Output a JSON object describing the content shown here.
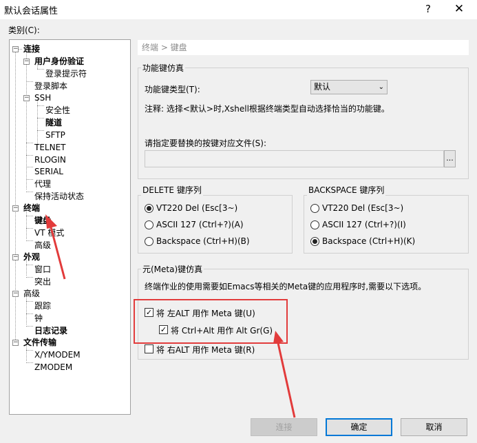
{
  "window": {
    "title": "默认会话属性",
    "help_label": "?",
    "close_label": "✕"
  },
  "category_label": "类别(C):",
  "tree": [
    {
      "label": "连接",
      "bold": true
    },
    {
      "label": "用户身份验证",
      "bold": true
    },
    {
      "label": "登录提示符",
      "bold": false
    },
    {
      "label": "登录脚本",
      "bold": false
    },
    {
      "label": "SSH",
      "bold": false
    },
    {
      "label": "安全性",
      "bold": false
    },
    {
      "label": "隧道",
      "bold": true
    },
    {
      "label": "SFTP",
      "bold": false
    },
    {
      "label": "TELNET",
      "bold": false
    },
    {
      "label": "RLOGIN",
      "bold": false
    },
    {
      "label": "SERIAL",
      "bold": false
    },
    {
      "label": "代理",
      "bold": false
    },
    {
      "label": "保持活动状态",
      "bold": false
    },
    {
      "label": "终端",
      "bold": true
    },
    {
      "label": "键盘",
      "bold": true
    },
    {
      "label": "VT 模式",
      "bold": false
    },
    {
      "label": "高级",
      "bold": false
    },
    {
      "label": "外观",
      "bold": true
    },
    {
      "label": "窗口",
      "bold": false
    },
    {
      "label": "突出",
      "bold": false
    },
    {
      "label": "高级",
      "bold": false
    },
    {
      "label": "跟踪",
      "bold": false
    },
    {
      "label": "钟",
      "bold": false
    },
    {
      "label": "日志记录",
      "bold": true
    },
    {
      "label": "文件传输",
      "bold": true
    },
    {
      "label": "X/YMODEM",
      "bold": false
    },
    {
      "label": "ZMODEM",
      "bold": false
    }
  ],
  "breadcrumb": "终端 > 键盘",
  "function_keys": {
    "group_title": "功能键仿真",
    "type_label": "功能键类型(T):",
    "type_value": "默认",
    "note": "注释: 选择<默认>时,Xshell根据终端类型自动选择恰当的功能键。",
    "file_label": "请指定要替换的按键对应文件(S):",
    "file_value": "",
    "browse_label": "..."
  },
  "delete_group": {
    "title": "DELETE 键序列",
    "options": [
      "VT220 Del (Esc[3~)",
      "ASCII 127 (Ctrl+?)(A)",
      "Backspace (Ctrl+H)(B)"
    ],
    "selected": 0
  },
  "backspace_group": {
    "title": "BACKSPACE 键序列",
    "options": [
      "VT220 Del (Esc[3~)",
      "ASCII 127 (Ctrl+?)(I)",
      "Backspace (Ctrl+H)(K)"
    ],
    "selected": 2
  },
  "meta": {
    "title": "元(Meta)键仿真",
    "description": "终端作业的使用需要如Emacs等相关的Meta键的应用程序时,需要以下选项。",
    "left_alt": {
      "label": "将 左ALT 用作 Meta 键(U)",
      "checked": true
    },
    "ctrl_alt": {
      "label": "将 Ctrl+Alt 用作 Alt Gr(G)",
      "checked": true
    },
    "right_alt": {
      "label": "将 右ALT 用作 Meta 键(R)",
      "checked": false
    }
  },
  "buttons": {
    "connect": "连接",
    "ok": "确定",
    "cancel": "取消"
  },
  "colors": {
    "annotation": "#e23b3b",
    "focus": "#0078d7"
  }
}
